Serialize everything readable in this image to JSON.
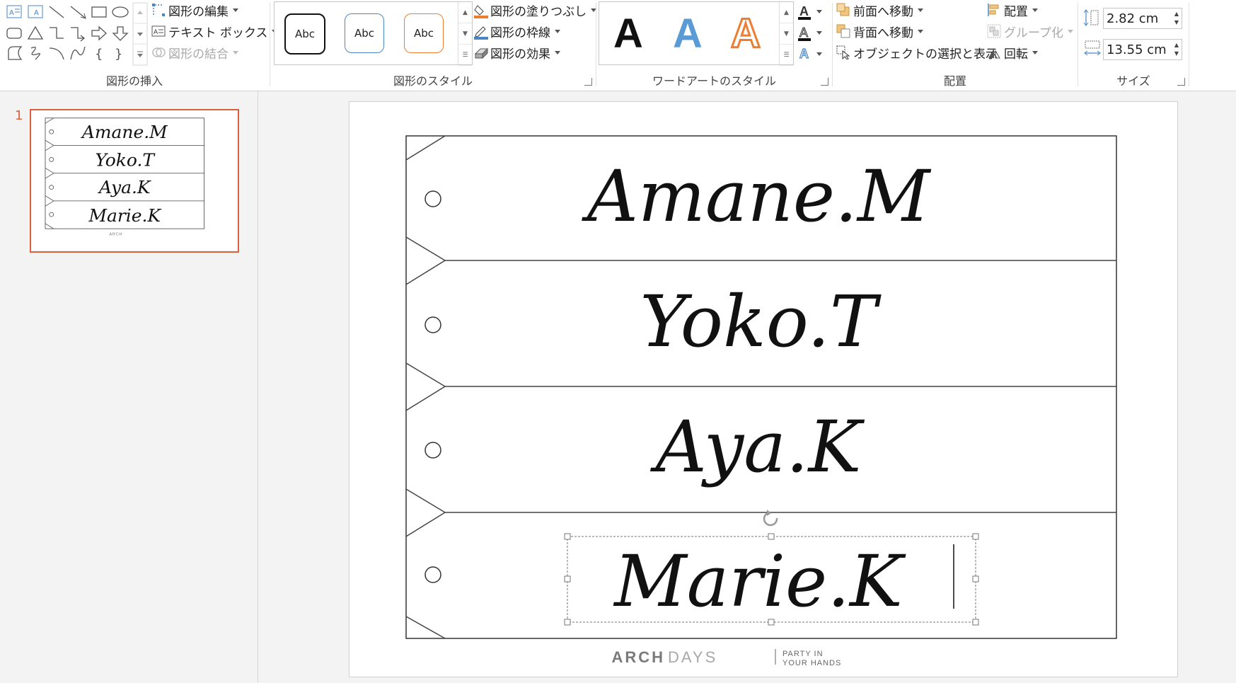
{
  "ribbon": {
    "insert_shapes": {
      "label": "図形の挿入",
      "edit_shape": "図形の編集",
      "text_box": "テキスト ボックス",
      "merge_shapes": "図形の結合"
    },
    "shape_styles": {
      "label": "図形のスタイル",
      "presets": [
        "Abc",
        "Abc",
        "Abc"
      ],
      "fill": "図形の塗りつぶし",
      "outline": "図形の枠線",
      "effects": "図形の効果"
    },
    "wordart_styles": {
      "label": "ワードアートのスタイル",
      "samples": [
        "A",
        "A",
        "A"
      ]
    },
    "arrange": {
      "label": "配置",
      "bring_forward": "前面へ移動",
      "send_backward": "背面へ移動",
      "selection_pane": "オブジェクトの選択と表示",
      "align": "配置",
      "group": "グループ化",
      "rotate": "回転"
    },
    "size": {
      "label": "サイズ",
      "height": "2.82 cm",
      "width": "13.55 cm"
    }
  },
  "thumbnails": [
    {
      "number": "1"
    }
  ],
  "slide": {
    "names": [
      "Amane.M",
      "Yoko.T",
      "Aya.K",
      "Marie.K"
    ],
    "logo_brand": "ARCH",
    "logo_brand_light": "DAYS",
    "logo_tagline_1": "PARTY IN",
    "logo_tagline_2": "YOUR HANDS"
  },
  "colors": {
    "selected_thumb": "#d9603a",
    "fill_accent": "#ed7d31",
    "outline_accent": "#4a86c5",
    "wordart_blue": "#5b9bd5",
    "wordart_orange": "#ed7d31"
  }
}
